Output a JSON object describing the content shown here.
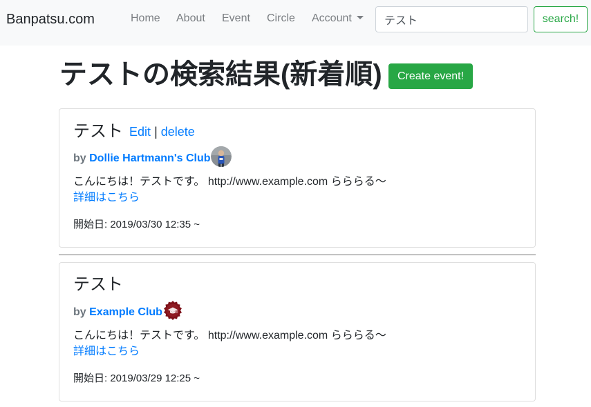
{
  "nav": {
    "brand": "Banpatsu.com",
    "home": "Home",
    "about": "About",
    "event": "Event",
    "circle": "Circle",
    "account": "Account",
    "search_value": "テスト",
    "search_button": "search!"
  },
  "header": {
    "title": "テストの検索結果(新着順)",
    "create_button": "Create event!"
  },
  "events": [
    {
      "title": "テスト",
      "edit_label": "Edit",
      "separator": "|",
      "delete_label": "delete",
      "by_label": "by",
      "club_name": "Dollie Hartmann's Club",
      "description": "こんにちは！テストです。 http://www.example.com らららる〜",
      "details_link": "詳細はこちら",
      "start": "開始日: 2019/03/30 12:35 ~"
    },
    {
      "title": "テスト",
      "by_label": "by",
      "club_name": "Example Club",
      "description": "こんにちは！テストです。 http://www.example.com らららる〜",
      "details_link": "詳細はこちら",
      "start": "開始日: 2019/03/29 12:25 ~"
    }
  ],
  "colors": {
    "link": "#007bff",
    "success": "#28a745",
    "navbar_bg": "#f8f9fa"
  }
}
